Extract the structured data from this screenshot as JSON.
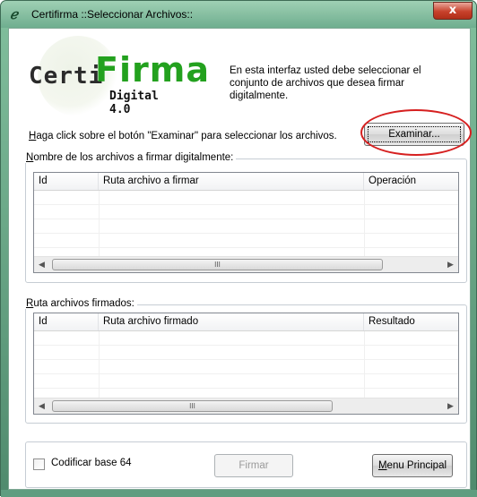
{
  "window": {
    "title": "Certifirma ::Seleccionar Archivos::",
    "close_label": "x",
    "icon": "certifirma-app-icon"
  },
  "logo": {
    "certi": "Certi",
    "firma": "Firma",
    "digital": "Digital 4.0"
  },
  "intro_text": "En esta interfaz usted debe seleccionar el conjunto de archivos que  desea firmar digitalmente.",
  "instruction": {
    "first_letter": "H",
    "rest": "aga click sobre el botón \"Examinar\" para seleccionar los archivos."
  },
  "examinar_button": "Examinar...",
  "files_group": {
    "label_first": "N",
    "label_rest": "ombre de los archivos a firmar digitalmente:",
    "columns": [
      "Id",
      "Ruta archivo a firmar",
      "Operación"
    ],
    "rows": []
  },
  "signed_group": {
    "label_first": "R",
    "label_rest": "uta archivos firmados:",
    "columns": [
      "Id",
      "Ruta archivo firmado",
      "Resultado"
    ],
    "rows": []
  },
  "scrollbar": {
    "left_arrow": "◀",
    "right_arrow": "▶",
    "thumb_grip": "III"
  },
  "bottom": {
    "checkbox_label": "Codificar base 64",
    "checkbox_checked": false,
    "firmar_label": "Firmar",
    "firmar_enabled": false,
    "menu_first": "M",
    "menu_rest": "enu Principal"
  },
  "colors": {
    "title_bar": "#6fae8f",
    "close_button": "#c7412b",
    "logo_green": "#23a11e",
    "annotation_circle": "#d62020"
  }
}
